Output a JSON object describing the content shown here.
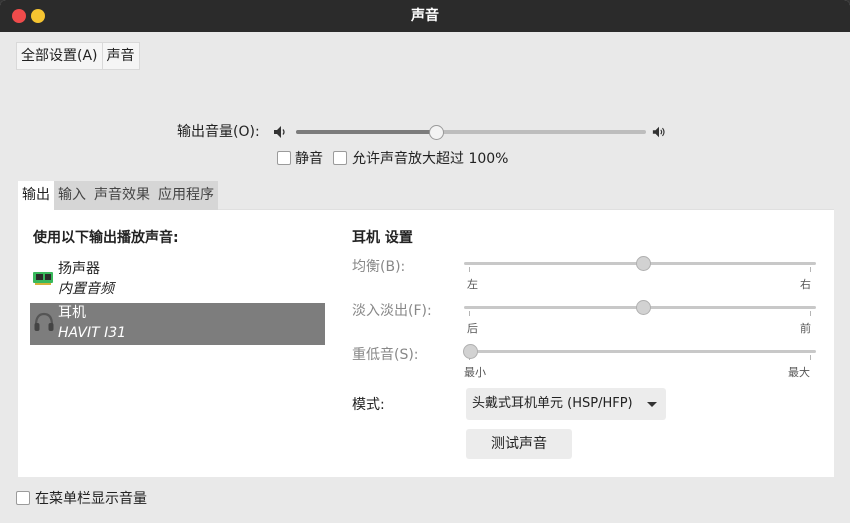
{
  "window": {
    "title": "声音",
    "close_color": "#ef4b4b",
    "minimize_color": "#f5c431"
  },
  "breadcrumb": {
    "items": [
      "全部设置(A)",
      "声音"
    ]
  },
  "volume": {
    "label": "输出音量(O):",
    "level_fraction": 0.4,
    "low_icon": "speaker-low-icon",
    "high_icon": "speaker-high-icon",
    "mute_label": "静音",
    "mute_checked": false,
    "amplify_label": "允许声音放大超过 100%",
    "amplify_checked": false
  },
  "tabs": [
    "输出",
    "输入",
    "声音效果",
    "应用程序"
  ],
  "active_tab": "输出",
  "output": {
    "heading": "使用以下输出播放声音:",
    "devices": [
      {
        "name": "扬声器",
        "sub": "内置音频",
        "icon": "sound-card-icon",
        "selected": false
      },
      {
        "name": "耳机",
        "sub": "HAVIT I31",
        "icon": "headphones-icon",
        "selected": true
      }
    ]
  },
  "settings": {
    "heading": "耳机 设置",
    "balance": {
      "label": "均衡(B):",
      "left_label": "左",
      "right_label": "右",
      "value_fraction": 0.5
    },
    "fade": {
      "label": "淡入淡出(F):",
      "left_label": "后",
      "right_label": "前",
      "value_fraction": 0.5
    },
    "bass": {
      "label": "重低音(S):",
      "left_label": "最小",
      "right_label": "最大",
      "value_fraction": 0.0
    },
    "mode": {
      "label": "模式:",
      "selected": "头戴式耳机单元 (HSP/HFP)"
    },
    "test_button": "测试声音"
  },
  "footer": {
    "show_in_menubar_label": "在菜单栏显示音量",
    "show_in_menubar_checked": false
  },
  "colors": {
    "selection": "#7d7d7d",
    "titlebar": "#2b2b2b"
  }
}
